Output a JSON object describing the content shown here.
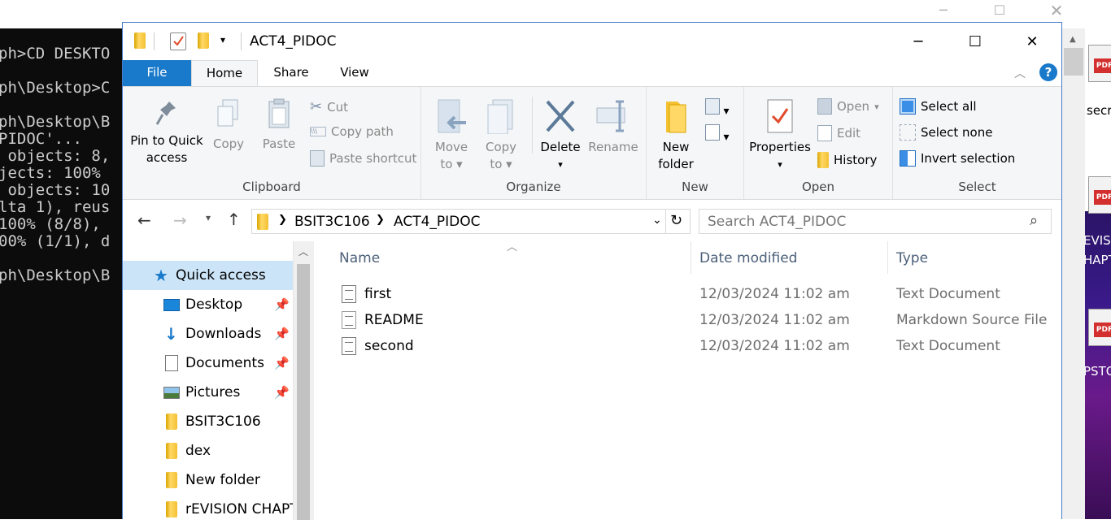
{
  "terminal": {
    "lines": [
      "ph>CD DESKTO",
      "ph\\Desktop>C",
      "ph\\Desktop\\B",
      "PIDOC'...",
      " objects: 8,",
      "jects: 100%",
      " objects: 10",
      "lta 1), reus",
      "100% (8/8),",
      "00% (1/1), d",
      "ph\\Desktop\\B"
    ]
  },
  "window": {
    "title": "ACT4_PIDOC",
    "min": "─",
    "max": "☐",
    "close": "✕"
  },
  "tabs": {
    "file": "File",
    "home": "Home",
    "share": "Share",
    "view": "View",
    "help": "?"
  },
  "ribbon": {
    "clipboard": {
      "group": "Clipboard",
      "pin_line1": "Pin to Quick",
      "pin_line2": "access",
      "copy": "Copy",
      "paste": "Paste",
      "cut": "Cut",
      "copy_path": "Copy path",
      "paste_shortcut": "Paste shortcut"
    },
    "organize": {
      "group": "Organize",
      "move_line1": "Move",
      "move_line2": "to",
      "copy_line1": "Copy",
      "copy_line2": "to",
      "delete": "Delete",
      "rename": "Rename"
    },
    "new": {
      "group": "New",
      "line1": "New",
      "line2": "folder"
    },
    "open": {
      "group": "Open",
      "properties": "Properties",
      "open": "Open",
      "edit": "Edit",
      "history": "History"
    },
    "select": {
      "group": "Select",
      "select_all": "Select all",
      "select_none": "Select none",
      "invert": "Invert selection"
    }
  },
  "address": {
    "crumbs": [
      "BSIT3C106",
      "ACT4_PIDOC"
    ],
    "search_placeholder": "Search ACT4_PIDOC"
  },
  "nav": {
    "quick_access": "Quick access",
    "items": [
      {
        "label": "Desktop",
        "pinned": true
      },
      {
        "label": "Downloads",
        "pinned": true
      },
      {
        "label": "Documents",
        "pinned": true
      },
      {
        "label": "Pictures",
        "pinned": true
      },
      {
        "label": "BSIT3C106",
        "pinned": false
      },
      {
        "label": "dex",
        "pinned": false
      },
      {
        "label": "New folder",
        "pinned": false
      },
      {
        "label": "rEVISION CHAPT",
        "pinned": false
      }
    ]
  },
  "content": {
    "columns": {
      "name": "Name",
      "date": "Date modified",
      "type": "Type"
    },
    "files": [
      {
        "name": "first",
        "date": "12/03/2024 11:02 am",
        "type": "Text Document"
      },
      {
        "name": "README",
        "date": "12/03/2024 11:02 am",
        "type": "Markdown Source File"
      },
      {
        "name": "second",
        "date": "12/03/2024 11:02 am",
        "type": "Text Document"
      }
    ]
  },
  "desktop": {
    "icons": [
      "secr",
      "EVISI",
      "HAPT",
      "PSTO"
    ],
    "pdf_tag": "PDF"
  },
  "colors": {
    "accent": "#1979ca",
    "folder": "#f3c132"
  }
}
